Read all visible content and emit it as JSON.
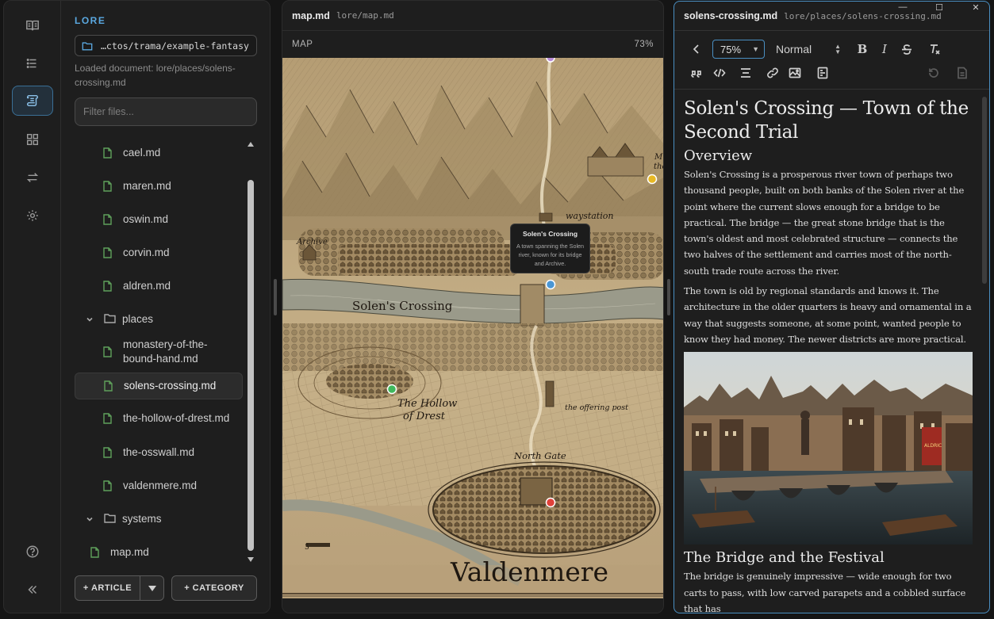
{
  "rail": {
    "items": [
      {
        "name": "book-icon",
        "active": false
      },
      {
        "name": "list-icon",
        "active": false
      },
      {
        "name": "scroll-icon",
        "active": true
      },
      {
        "name": "grid-icon",
        "active": false
      },
      {
        "name": "swap-icon",
        "active": false
      },
      {
        "name": "gear-icon",
        "active": false
      }
    ],
    "bottom": [
      "help-icon",
      "collapse-icon"
    ]
  },
  "sidebar": {
    "section_label": "LORE",
    "path": "…ctos/trama/example-fantasy",
    "loaded": "Loaded document: lore/places/solens-crossing.md",
    "filter_placeholder": "Filter files...",
    "tree": [
      {
        "type": "file",
        "label": "cael.md"
      },
      {
        "type": "file",
        "label": "maren.md"
      },
      {
        "type": "file",
        "label": "oswin.md"
      },
      {
        "type": "file",
        "label": "corvin.md"
      },
      {
        "type": "file",
        "label": "aldren.md"
      },
      {
        "type": "folder",
        "label": "places"
      },
      {
        "type": "file",
        "label": "monastery-of-the-bound-hand.md"
      },
      {
        "type": "file",
        "label": "solens-crossing.md",
        "selected": true
      },
      {
        "type": "file",
        "label": "the-hollow-of-drest.md"
      },
      {
        "type": "file",
        "label": "the-osswall.md"
      },
      {
        "type": "file",
        "label": "valdenmere.md"
      },
      {
        "type": "folder",
        "label": "systems"
      },
      {
        "type": "file",
        "label": "map.md"
      }
    ],
    "article_button": "+ ARTICLE",
    "category_button": "+ CATEGORY"
  },
  "map_panel": {
    "title": "map.md",
    "path": "lore/map.md",
    "label": "MAP",
    "zoom": "73%",
    "map_labels": {
      "waystation": "waystation",
      "archive": "Archive",
      "solens_crossing": "Solen's Crossing",
      "hollow": "The Hollow",
      "of_drest": "of Drest",
      "offering_post": "the offering post",
      "north_gate": "North Gate",
      "valdenmere": "Valdenmere",
      "m_label": "M",
      "the_label": "the",
      "scale_label": "5"
    },
    "tooltip": {
      "title": "Solen's Crossing",
      "desc": "A town spanning the Solen river, known for its bridge and Archive."
    },
    "pin_colors": {
      "purple": "#b78ad6",
      "yellow": "#e7b824",
      "blue": "#4a96d4",
      "green": "#3fb85c",
      "red": "#e0413a"
    }
  },
  "editor": {
    "title": "solens-crossing.md",
    "path": "lore/places/solens-crossing.md",
    "zoom": "75%",
    "block_style": "Normal",
    "toolbar_icons": [
      "back-icon",
      "bold-icon",
      "italic-icon",
      "strikethrough-icon",
      "clear-format-icon",
      "quote-icon",
      "code-icon",
      "align-icon",
      "link-icon",
      "image-icon",
      "embed-icon",
      "undo-icon",
      "save-icon"
    ],
    "doc": {
      "h1": "Solen's Crossing — Town of the Second Trial",
      "h2_overview": "Overview",
      "p1": "Solen's Crossing is a prosperous river town of perhaps two thousand people, built on both banks of the Solen river at the point where the current slows enough for a bridge to be practical. The bridge — the great stone bridge that is the town's oldest and most celebrated structure — connects the two halves of the settlement and carries most of the north-south trade route across the river.",
      "p2": "The town is old by regional standards and knows it. The architecture in the older quarters is heavy and ornamental in a way that suggests someone, at some point, wanted people to know they had money. The newer districts are more practical.",
      "image_banner": "ALDRIC",
      "h2_bridge": "The Bridge and the Festival",
      "p3": "The bridge is genuinely impressive — wide enough for two carts to pass, with low carved parapets and a cobbled surface that has"
    }
  },
  "window": {
    "minimize": "—",
    "maximize": "☐",
    "close": "✕"
  },
  "colors": {
    "accent": "#5aa8e0",
    "file_icon": "#5fa05b",
    "editor_border": "#4a8fc2"
  }
}
